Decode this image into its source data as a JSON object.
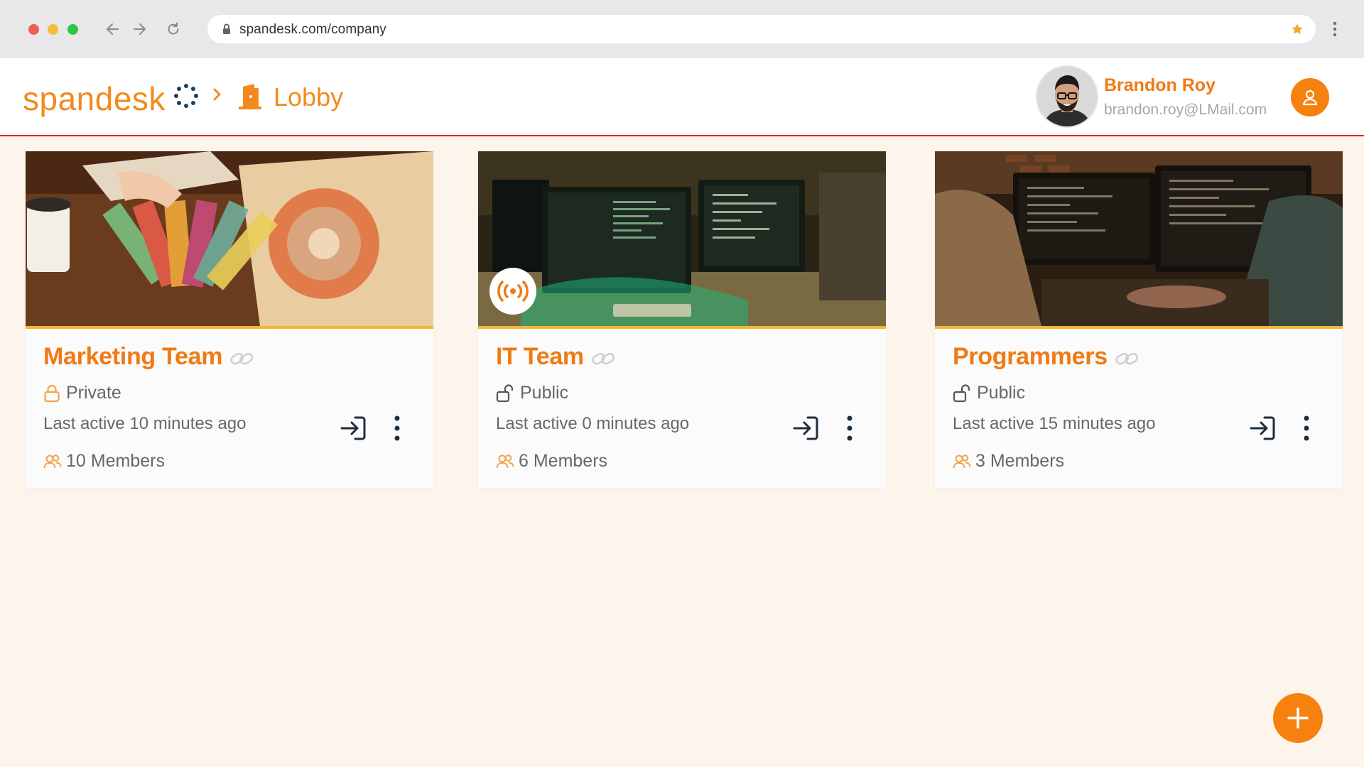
{
  "browser": {
    "url": "spandesk.com/company"
  },
  "header": {
    "brand": "spandesk",
    "breadcrumb_current": "Lobby",
    "user": {
      "name": "Brandon Roy",
      "email": "brandon.roy@LMail.com"
    }
  },
  "cards": [
    {
      "title": "Marketing Team",
      "privacy": "Private",
      "privacy_icon": "lock-closed-icon",
      "last_active": "Last active 10 minutes ago",
      "members": "10 Members",
      "live": false
    },
    {
      "title": "IT Team",
      "privacy": "Public",
      "privacy_icon": "lock-open-icon",
      "last_active": "Last active 0 minutes ago",
      "members": "6 Members",
      "live": true
    },
    {
      "title": "Programmers",
      "privacy": "Public",
      "privacy_icon": "lock-open-icon",
      "last_active": "Last active 15 minutes ago",
      "members": "3 Members",
      "live": false
    }
  ],
  "colors": {
    "accent": "#f07a14",
    "button": "#f5820f",
    "image_underline": "#f6b533",
    "header_border": "#cf2d2d",
    "page_background": "#fdf4ec"
  }
}
